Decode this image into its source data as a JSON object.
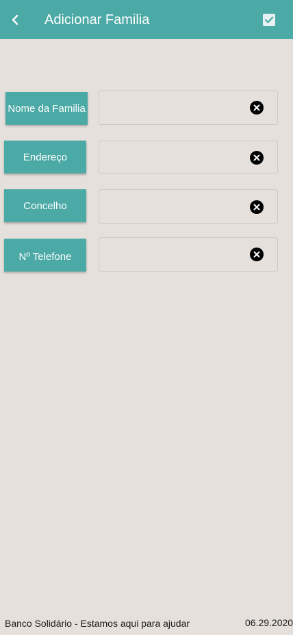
{
  "header": {
    "title": "Adicionar Familia",
    "back_icon": "chevron-left-icon",
    "confirm_icon": "check-box-icon"
  },
  "form": {
    "fields": [
      {
        "label": "Nome da Familia",
        "value": "",
        "clear_icon": "close-circle-icon"
      },
      {
        "label": "Endereço",
        "value": "",
        "clear_icon": "close-circle-icon"
      },
      {
        "label": "Concelho",
        "value": "",
        "clear_icon": "close-circle-icon"
      },
      {
        "label": "Nº Telefone",
        "value": "",
        "clear_icon": "close-circle-icon"
      }
    ]
  },
  "footer": {
    "text": "Banco Solidário - Estamos aqui para ajudar",
    "date": "06.29.2020"
  },
  "colors": {
    "accent": "#4ba9a6",
    "background": "#e5e0dc"
  }
}
